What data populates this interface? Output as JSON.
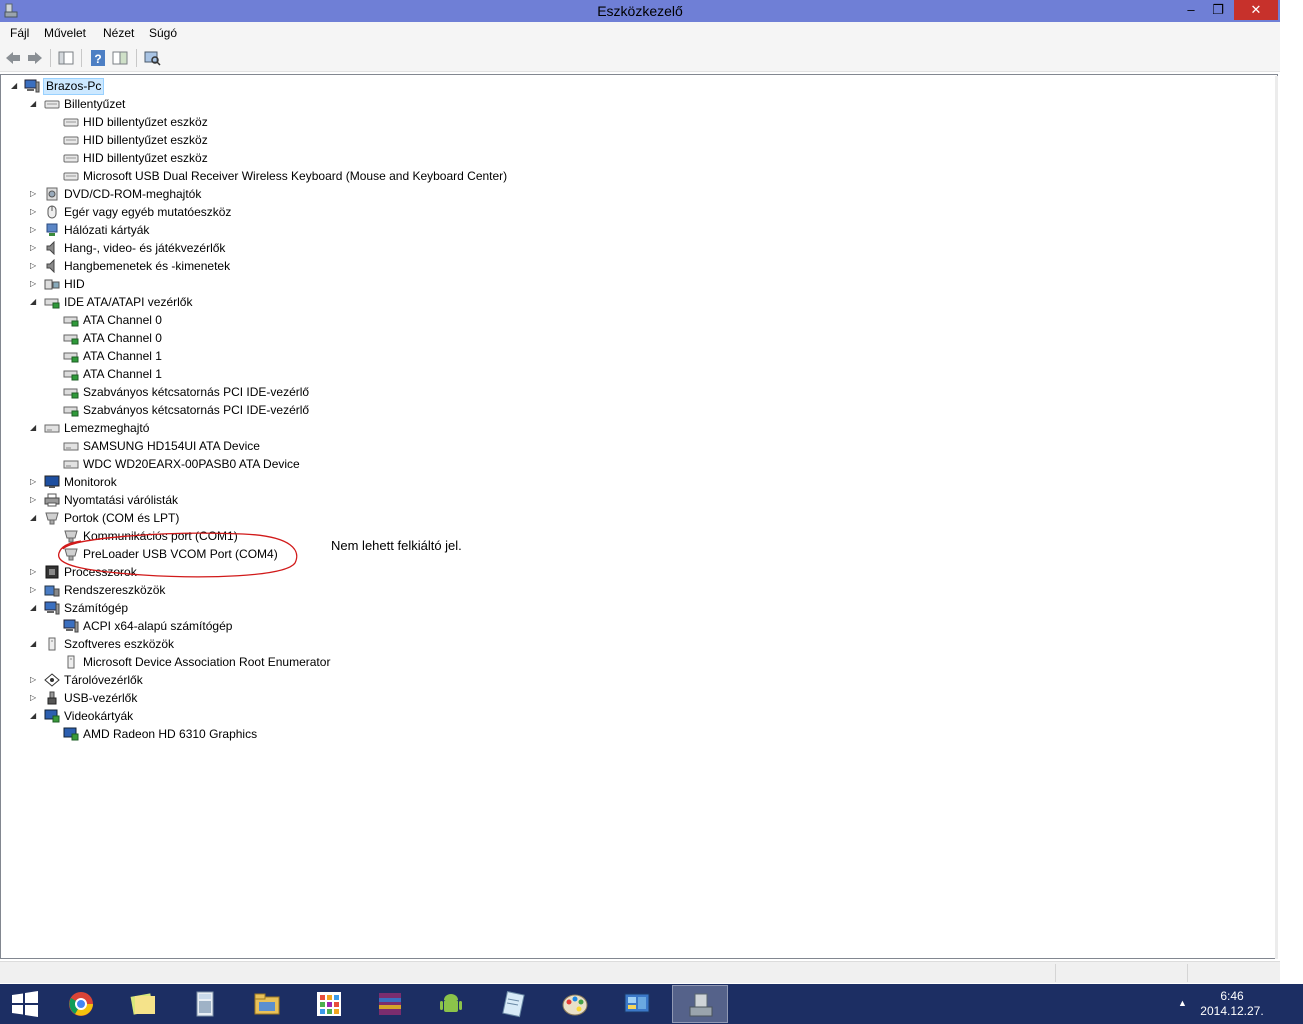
{
  "window": {
    "title": "Eszközkezelő",
    "min_symbol": "–",
    "max_symbol": "❐",
    "close_symbol": "✕"
  },
  "menu": {
    "file": "Fájl",
    "action": "Művelet",
    "view": "Nézet",
    "help": "Súgó"
  },
  "toolbar": {
    "icons": [
      "back-arrow-icon",
      "forward-arrow-icon",
      "console-tree-icon",
      "help-icon",
      "properties-icon",
      "scan-hardware-icon"
    ]
  },
  "tree": {
    "root": "Brazos-Pc",
    "items": [
      {
        "label": "Billentyűzet",
        "expanded": true,
        "icon": "keyboard-icon"
      },
      {
        "label": "HID billentyűzet eszköz",
        "icon": "keyboard-icon"
      },
      {
        "label": "HID billentyűzet eszköz",
        "icon": "keyboard-icon"
      },
      {
        "label": "HID billentyűzet eszköz",
        "icon": "keyboard-icon"
      },
      {
        "label": "Microsoft USB Dual Receiver Wireless Keyboard (Mouse and Keyboard Center)",
        "icon": "keyboard-icon"
      },
      {
        "label": "DVD/CD-ROM-meghajtók",
        "expanded": false,
        "icon": "dvd-drive-icon"
      },
      {
        "label": "Egér vagy egyéb mutatóeszköz",
        "expanded": false,
        "icon": "mouse-icon"
      },
      {
        "label": "Hálózati kártyák",
        "expanded": false,
        "icon": "network-adapter-icon"
      },
      {
        "label": "Hang-, video- és játékvezérlők",
        "expanded": false,
        "icon": "speaker-icon"
      },
      {
        "label": "Hangbemenetek és -kimenetek",
        "expanded": false,
        "icon": "speaker-icon"
      },
      {
        "label": "HID",
        "expanded": false,
        "icon": "hid-icon"
      },
      {
        "label": "IDE ATA/ATAPI vezérlők",
        "expanded": true,
        "icon": "ide-controller-icon"
      },
      {
        "label": "ATA Channel 0",
        "icon": "ide-controller-icon"
      },
      {
        "label": "ATA Channel 0",
        "icon": "ide-controller-icon"
      },
      {
        "label": "ATA Channel 1",
        "icon": "ide-controller-icon"
      },
      {
        "label": "ATA Channel 1",
        "icon": "ide-controller-icon"
      },
      {
        "label": "Szabványos kétcsatornás PCI IDE-vezérlő",
        "icon": "ide-controller-icon"
      },
      {
        "label": "Szabványos kétcsatornás PCI IDE-vezérlő",
        "icon": "ide-controller-icon"
      },
      {
        "label": "Lemezmeghajtó",
        "expanded": true,
        "icon": "disk-drive-icon"
      },
      {
        "label": "SAMSUNG HD154UI ATA Device",
        "icon": "disk-drive-icon"
      },
      {
        "label": "WDC WD20EARX-00PASB0 ATA Device",
        "icon": "disk-drive-icon"
      },
      {
        "label": "Monitorok",
        "expanded": false,
        "icon": "monitor-icon"
      },
      {
        "label": "Nyomtatási várólisták",
        "expanded": false,
        "icon": "printer-icon"
      },
      {
        "label": "Portok (COM és LPT)",
        "expanded": true,
        "icon": "port-icon"
      },
      {
        "label": "Kommunikációs port (COM1)",
        "icon": "port-icon"
      },
      {
        "label": "PreLoader USB VCOM Port (COM4)",
        "icon": "port-icon"
      },
      {
        "label": "Processzorok",
        "expanded": false,
        "icon": "processor-icon"
      },
      {
        "label": "Rendszereszközök",
        "expanded": false,
        "icon": "system-device-icon"
      },
      {
        "label": "Számítógép",
        "expanded": true,
        "icon": "computer-icon"
      },
      {
        "label": "ACPI x64-alapú számítógép",
        "icon": "computer-icon"
      },
      {
        "label": "Szoftveres eszközök",
        "expanded": true,
        "icon": "software-device-icon"
      },
      {
        "label": "Microsoft Device Association Root Enumerator",
        "icon": "software-device-icon"
      },
      {
        "label": "Tárolóvezérlők",
        "expanded": false,
        "icon": "storage-controller-icon"
      },
      {
        "label": "USB-vezérlők",
        "expanded": false,
        "icon": "usb-icon"
      },
      {
        "label": "Videokártyák",
        "expanded": true,
        "icon": "display-adapter-icon"
      },
      {
        "label": "AMD Radeon HD 6310 Graphics",
        "icon": "display-adapter-icon"
      }
    ]
  },
  "annotation": {
    "text": "Nem lehett felkiáltó jel."
  },
  "taskbar": {
    "apps": [
      "chrome-icon",
      "sticky-notes-icon",
      "calculator-icon",
      "file-explorer-icon",
      "store-apps-icon",
      "winrar-icon",
      "android-icon",
      "notepad-icon",
      "paint-icon",
      "control-panel-icon",
      "device-manager-icon"
    ],
    "time": "6:46",
    "date": "2014.12.27."
  },
  "colors": {
    "titlebar": "#6f7fd6",
    "close": "#c7312b",
    "taskbar": "#1c2e63",
    "selection": "#cce8ff",
    "annotation_circle": "#d11a1a"
  }
}
